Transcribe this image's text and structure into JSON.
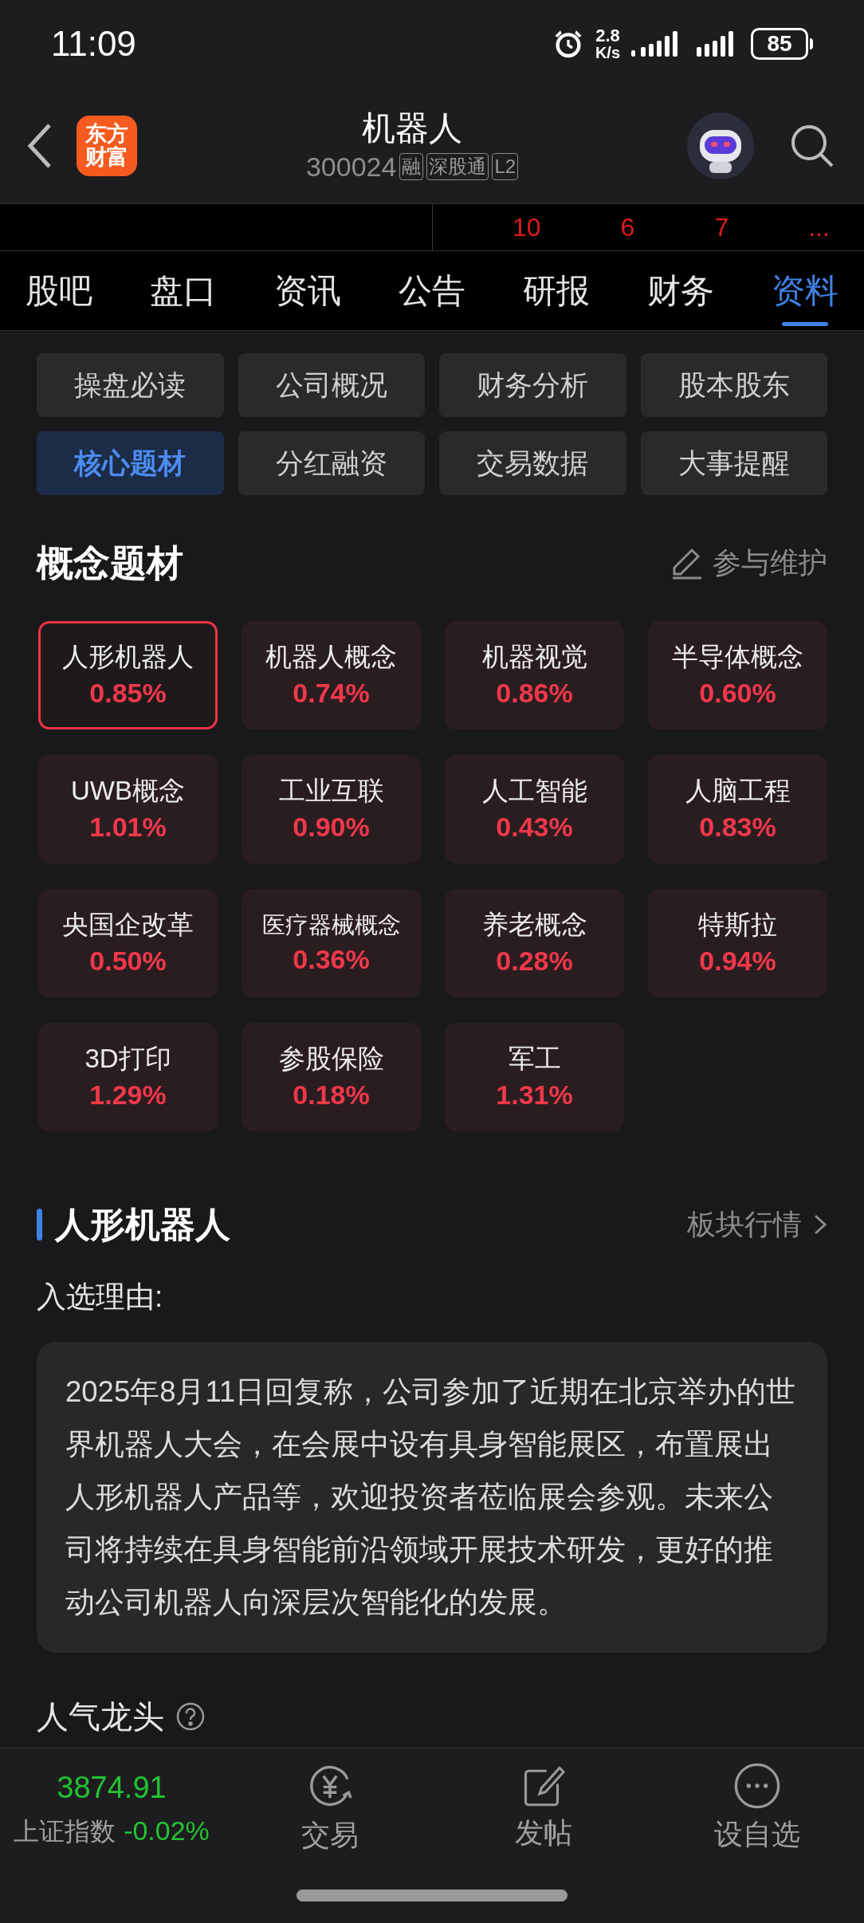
{
  "status_bar": {
    "time": "11:09",
    "net_speed_value": "2.8",
    "net_speed_unit": "K/s",
    "battery": "85"
  },
  "header": {
    "logo_top": "东方",
    "logo_bottom": "财富",
    "title": "机器人",
    "code": "300024",
    "badges": [
      "融",
      "深股通",
      "L2"
    ]
  },
  "ticker": [
    "10",
    "6",
    "7",
    "..."
  ],
  "tabs": [
    {
      "label": "股吧",
      "selected": false
    },
    {
      "label": "盘口",
      "selected": false
    },
    {
      "label": "资讯",
      "selected": false
    },
    {
      "label": "公告",
      "selected": false
    },
    {
      "label": "研报",
      "selected": false
    },
    {
      "label": "财务",
      "selected": false
    },
    {
      "label": "资料",
      "selected": true
    }
  ],
  "sub_tabs": [
    {
      "label": "操盘必读",
      "selected": false
    },
    {
      "label": "公司概况",
      "selected": false
    },
    {
      "label": "财务分析",
      "selected": false
    },
    {
      "label": "股本股东",
      "selected": false
    },
    {
      "label": "核心题材",
      "selected": true
    },
    {
      "label": "分红融资",
      "selected": false
    },
    {
      "label": "交易数据",
      "selected": false
    },
    {
      "label": "大事提醒",
      "selected": false
    }
  ],
  "concepts_section": {
    "title": "概念题材",
    "action": "参与维护"
  },
  "concepts": [
    {
      "name": "人形机器人",
      "change": "0.85%",
      "selected": true
    },
    {
      "name": "机器人概念",
      "change": "0.74%",
      "selected": false
    },
    {
      "name": "机器视觉",
      "change": "0.86%",
      "selected": false
    },
    {
      "name": "半导体概念",
      "change": "0.60%",
      "selected": false
    },
    {
      "name": "UWB概念",
      "change": "1.01%",
      "selected": false
    },
    {
      "name": "工业互联",
      "change": "0.90%",
      "selected": false
    },
    {
      "name": "人工智能",
      "change": "0.43%",
      "selected": false
    },
    {
      "name": "人脑工程",
      "change": "0.83%",
      "selected": false
    },
    {
      "name": "央国企改革",
      "change": "0.50%",
      "selected": false
    },
    {
      "name": "医疗器械概念",
      "change": "0.36%",
      "selected": false
    },
    {
      "name": "养老概念",
      "change": "0.28%",
      "selected": false
    },
    {
      "name": "特斯拉",
      "change": "0.94%",
      "selected": false
    },
    {
      "name": "3D打印",
      "change": "1.29%",
      "selected": false
    },
    {
      "name": "参股保险",
      "change": "0.18%",
      "selected": false
    },
    {
      "name": "军工",
      "change": "1.31%",
      "selected": false
    }
  ],
  "detail": {
    "title": "人形机器人",
    "link": "板块行情",
    "reason_label": "入选理由:",
    "reason": "2025年8月11日回复称，公司参加了近期在北京举办的世界机器人大会，在会展中设有具身智能展区，布置展出人形机器人产品等，欢迎投资者莅临展会参观。未来公司将持续在具身智能前沿领域开展技术研发，更好的推动公司机器人向深层次智能化的发展。",
    "next_title": "人气龙头"
  },
  "bottom_bar": {
    "index_value": "3874.91",
    "index_name": "上证指数",
    "index_change": "-0.02%",
    "actions": [
      {
        "kind": "trade",
        "label": "交易"
      },
      {
        "kind": "post",
        "label": "发帖"
      },
      {
        "kind": "watch",
        "label": "设自选"
      }
    ]
  }
}
